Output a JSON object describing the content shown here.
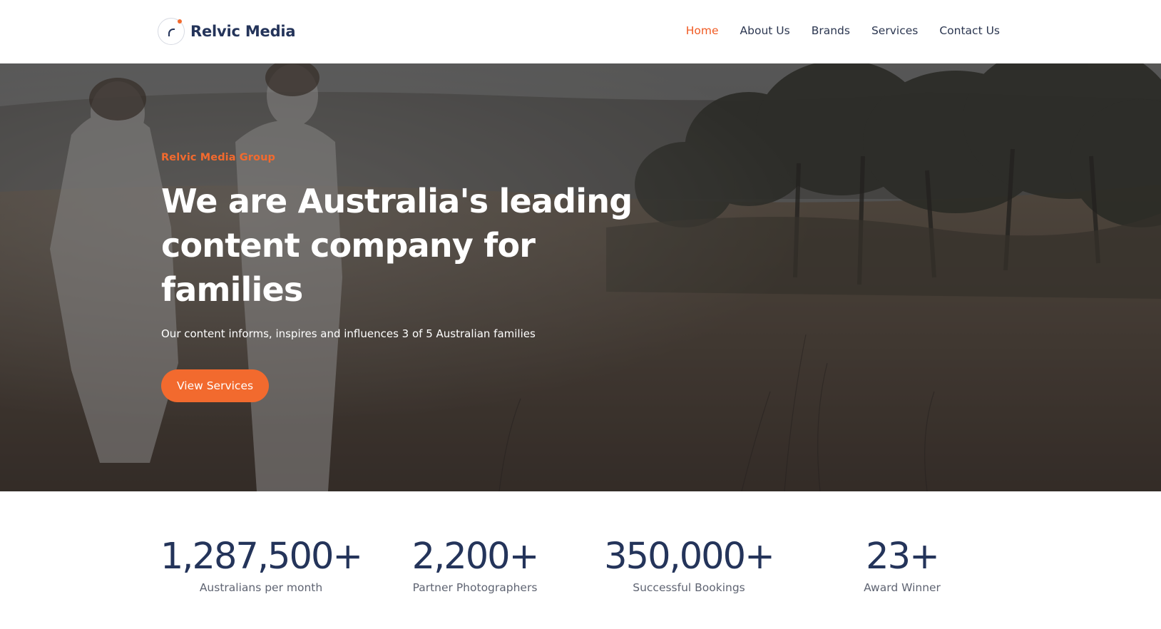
{
  "header": {
    "logo_text": "Relvic Media",
    "nav": [
      {
        "label": "Home",
        "active": true
      },
      {
        "label": "About Us",
        "active": false
      },
      {
        "label": "Brands",
        "active": false
      },
      {
        "label": "Services",
        "active": false
      },
      {
        "label": "Contact Us",
        "active": false
      }
    ]
  },
  "hero": {
    "eyebrow": "Relvic Media Group",
    "headline": "We are Australia's leading content company for families",
    "subtext": "Our content informs, inspires and influences 3 of 5 Australian families",
    "cta_label": "View Services",
    "image": "family walking in an autumn field with trees"
  },
  "stats": [
    {
      "value": "1,287,500+",
      "label": "Australians per month"
    },
    {
      "value": "2,200+",
      "label": "Partner Photographers"
    },
    {
      "value": "350,000+",
      "label": "Successful Bookings"
    },
    {
      "value": "23+",
      "label": "Award Winner"
    }
  ],
  "colors": {
    "accent": "#f26a2e",
    "nav_active": "#f05a22",
    "navy": "#24345a",
    "muted_text": "#5f6472"
  }
}
